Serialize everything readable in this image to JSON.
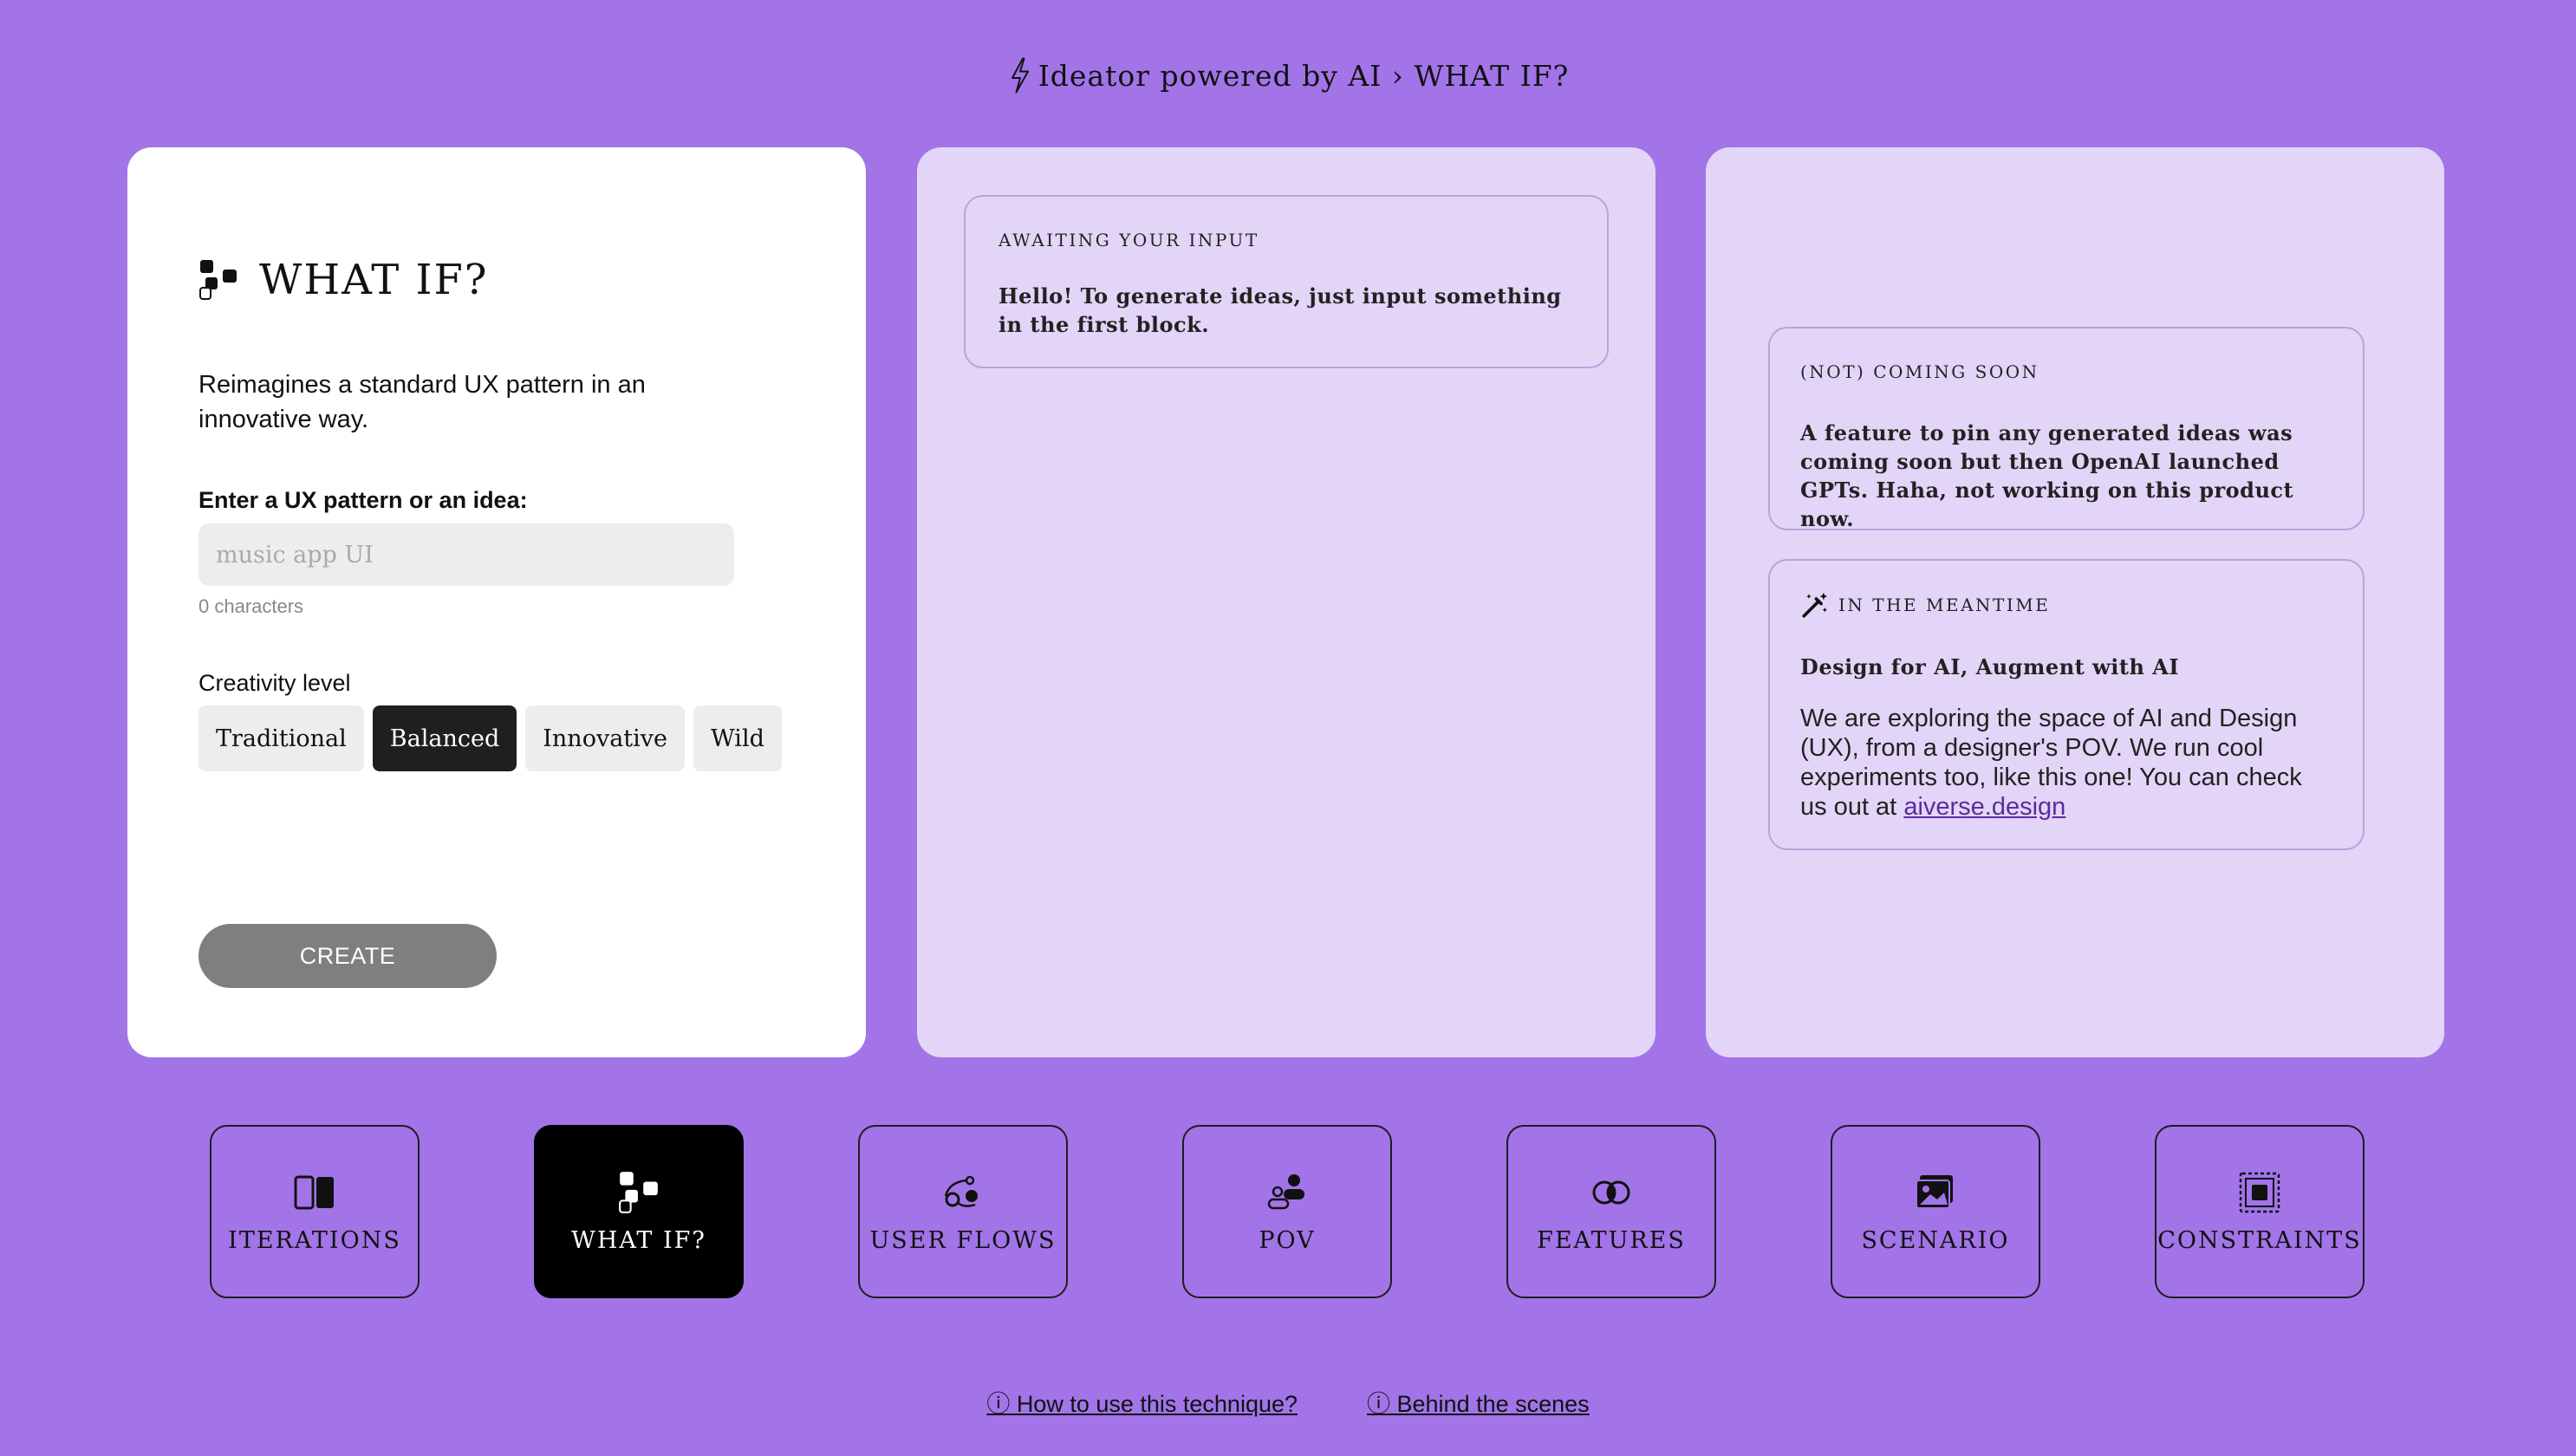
{
  "header": {
    "icon": "lightning-icon",
    "title": "Ideator powered by AI › WHAT IF?"
  },
  "input_panel": {
    "title": "WHAT IF?",
    "description": "Reimagines a standard UX pattern in an innovative way.",
    "field_label": "Enter a UX pattern or an idea:",
    "field_placeholder": "music app UI",
    "char_count": "0 characters",
    "creativity_label": "Creativity level",
    "creativity_options": [
      "Traditional",
      "Balanced",
      "Innovative",
      "Wild"
    ],
    "selected_option": "Balanced",
    "create_label": "CREATE"
  },
  "output_panel": {
    "kicker": "AWAITING YOUR INPUT",
    "body": "Hello! To generate ideas, just input something in the first block."
  },
  "info_panel": {
    "soon_kicker": "(NOT) COMING SOON",
    "soon_body": "A feature to pin any generated ideas was coming soon but then OpenAI launched GPTs. Haha, not working on this product now.",
    "mean_kicker": "IN THE MEANTIME",
    "mean_heading": "Design for AI, Augment with AI",
    "mean_body": "We are exploring the space of AI and Design (UX), from a designer's POV. We run cool experiments too, like this one! You can check us out at ",
    "mean_link": "aiverse.design"
  },
  "nav": {
    "items": [
      {
        "label": "ITERATIONS",
        "icon": "iterations-icon"
      },
      {
        "label": "WHAT IF?",
        "icon": "what-if-icon",
        "active": true
      },
      {
        "label": "USER FLOWS",
        "icon": "user-flows-icon"
      },
      {
        "label": "POV",
        "icon": "pov-icon"
      },
      {
        "label": "FEATURES",
        "icon": "features-icon"
      },
      {
        "label": "SCENARIO",
        "icon": "scenario-icon"
      },
      {
        "label": "CONSTRAINTS",
        "icon": "constraints-icon"
      }
    ]
  },
  "footer": {
    "how_to": "ⓘ How to use this technique?",
    "behind": "ⓘ Behind the scenes"
  },
  "colors": {
    "background": "#a274e8",
    "card": "#e3d5f7",
    "active": "#000000"
  }
}
